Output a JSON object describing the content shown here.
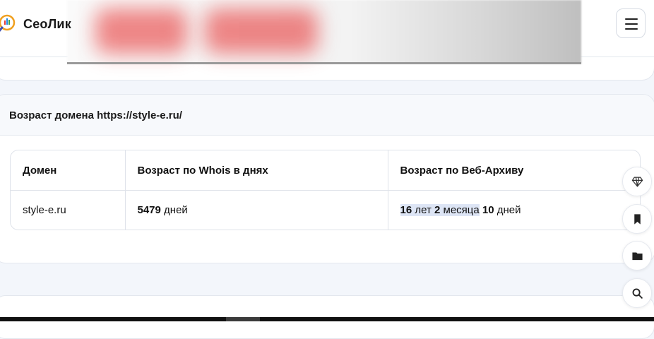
{
  "header": {
    "logo_text": "СеоЛик",
    "menu_icon": "hamburger-icon"
  },
  "domain_age": {
    "title": "Возраст домена https://style-e.ru/",
    "columns": [
      "Домен",
      "Возраст по Whois в днях",
      "Возраст по Веб-Архиву"
    ],
    "row": {
      "domain": "style-e.ru",
      "whois_days": "5479",
      "whois_unit": "дней",
      "archive_years": "16",
      "archive_years_unit": "лет",
      "archive_months": "2",
      "archive_months_unit": "месяца",
      "archive_days": "10",
      "archive_days_unit": "дней"
    }
  },
  "side_tools": [
    "diamond-icon",
    "bookmark-icon",
    "folder-icon",
    "search-icon"
  ],
  "colors": {
    "accent_red": "#e62828",
    "highlight": "#dde5f5",
    "background": "#f3f6fb"
  }
}
